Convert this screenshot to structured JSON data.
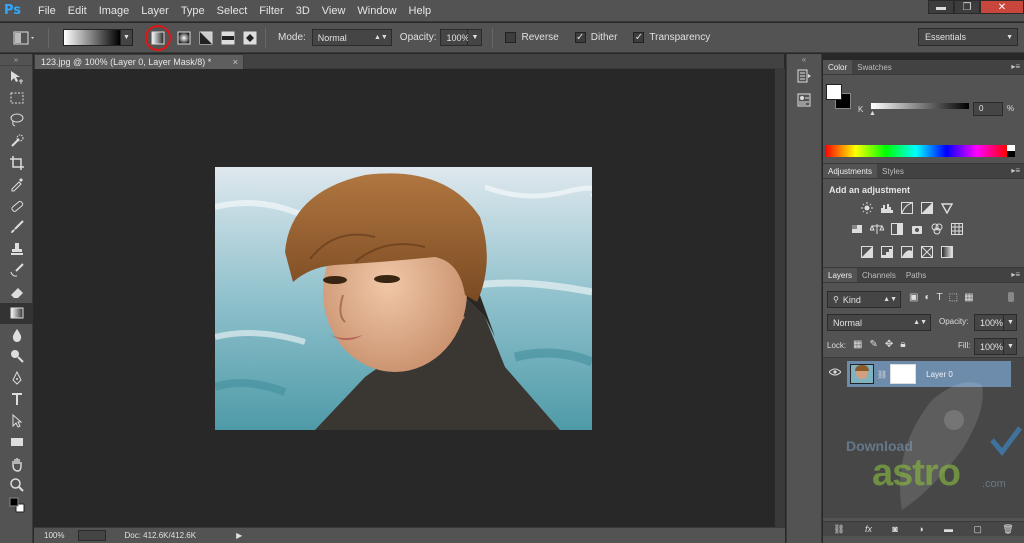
{
  "app": {
    "logo": "Ps"
  },
  "menu": [
    "File",
    "Edit",
    "Image",
    "Layer",
    "Type",
    "Select",
    "Filter",
    "3D",
    "View",
    "Window",
    "Help"
  ],
  "window_controls": {
    "minimize": "▬",
    "restore": "❐",
    "close": "✕"
  },
  "options": {
    "mode_label": "Mode:",
    "mode_value": "Normal",
    "opacity_label": "Opacity:",
    "opacity_value": "100%",
    "reverse_label": "Reverse",
    "dither_label": "Dither",
    "transparency_label": "Transparency",
    "dither_checked": "✓",
    "transparency_checked": "✓",
    "workspace": "Essentials"
  },
  "document": {
    "tab_title": "123.jpg @ 100% (Layer 0, Layer Mask/8) *",
    "tab_close": "×"
  },
  "status": {
    "zoom": "100%",
    "doc_info": "Doc: 412.6K/412.6K"
  },
  "color_panel": {
    "tabs": [
      "Color",
      "Swatches"
    ],
    "channel_label": "K",
    "channel_value": "0",
    "channel_unit": "%"
  },
  "adjustments_panel": {
    "tabs": [
      "Adjustments",
      "Styles"
    ],
    "heading": "Add an adjustment"
  },
  "layers_panel": {
    "tabs": [
      "Layers",
      "Channels",
      "Paths"
    ],
    "filter_kind": "Kind",
    "blend_mode": "Normal",
    "opacity_label": "Opacity:",
    "opacity_value": "100%",
    "lock_label": "Lock:",
    "fill_label": "Fill:",
    "fill_value": "100%",
    "layers": [
      {
        "name": "Layer 0",
        "visible": true,
        "selected": true
      }
    ]
  },
  "watermark": {
    "line1": "Download",
    "line2": "astro",
    "line3": ".com"
  },
  "colors": {
    "chrome": "#535353",
    "canvas_bg": "#282828",
    "selected_layer": "#6d8bab",
    "highlight_ring": "#e01515",
    "ps_blue": "#31a8ff"
  }
}
